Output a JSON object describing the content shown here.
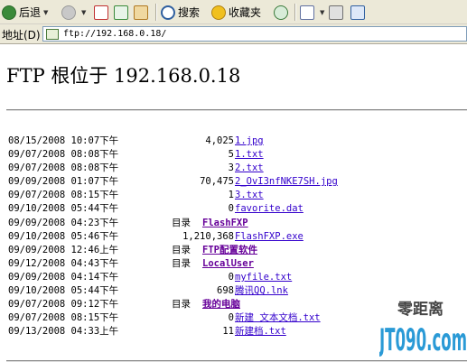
{
  "toolbar": {
    "back_label": "后退",
    "search_label": "搜索",
    "favorites_label": "收藏夹"
  },
  "address": {
    "label": "地址(D)",
    "url": "ftp://192.168.0.18/"
  },
  "page": {
    "title": "FTP 根位于 192.168.0.18"
  },
  "listing": {
    "dir_label": "目录",
    "entries": [
      {
        "date": "08/15/2008 10:07下午",
        "type": "file",
        "size": "4,025",
        "name": "1.jpg"
      },
      {
        "date": "09/07/2008 08:08下午",
        "type": "file",
        "size": "5",
        "name": "1.txt"
      },
      {
        "date": "09/07/2008 08:08下午",
        "type": "file",
        "size": "3",
        "name": "2.txt"
      },
      {
        "date": "09/09/2008 01:07下午",
        "type": "file",
        "size": "70,475",
        "name": "2_OvI3nfNKE7SH.jpg"
      },
      {
        "date": "09/07/2008 08:15下午",
        "type": "file",
        "size": "1",
        "name": "3.txt"
      },
      {
        "date": "09/10/2008 05:44下午",
        "type": "file",
        "size": "0",
        "name": "favorite.dat"
      },
      {
        "date": "09/09/2008 04:23下午",
        "type": "dir",
        "size": "",
        "name": "FlashFXP"
      },
      {
        "date": "09/10/2008 05:46下午",
        "type": "file",
        "size": "1,210,368",
        "name": "FlashFXP.exe"
      },
      {
        "date": "09/09/2008 12:46上午",
        "type": "dir",
        "size": "",
        "name": "FTP配置软件"
      },
      {
        "date": "09/12/2008 04:43下午",
        "type": "dir",
        "size": "",
        "name": "LocalUser"
      },
      {
        "date": "09/09/2008 04:14下午",
        "type": "file",
        "size": "0",
        "name": "myfile.txt"
      },
      {
        "date": "09/10/2008 05:44下午",
        "type": "file",
        "size": "698",
        "name": "腾讯QQ.lnk"
      },
      {
        "date": "09/07/2008 09:12下午",
        "type": "dir",
        "size": "",
        "name": "我的电脑"
      },
      {
        "date": "09/07/2008 08:15下午",
        "type": "file",
        "size": "0",
        "name": "新建 文本文档.txt"
      },
      {
        "date": "09/13/2008 04:33上午",
        "type": "file",
        "size": "11",
        "name": "新建档.txt"
      }
    ]
  },
  "watermark": {
    "text_top": "零距离",
    "text_main": "JT090.com"
  },
  "colors": {
    "link": "#3300cc",
    "dir_link": "#660099",
    "chrome": "#ece9d8"
  }
}
